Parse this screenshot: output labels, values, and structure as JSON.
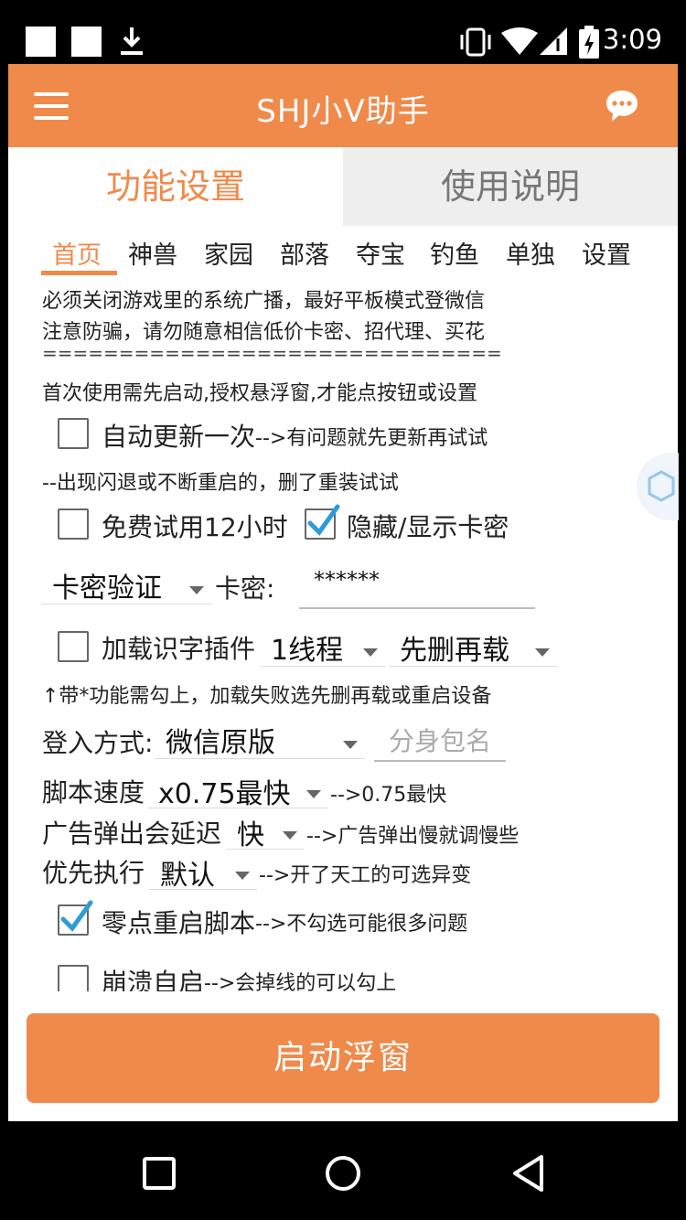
{
  "status_bar": {
    "time": "3:09"
  },
  "app_bar": {
    "title": "SHJ小V助手"
  },
  "main_tabs": [
    {
      "label": "功能设置"
    },
    {
      "label": "使用说明"
    }
  ],
  "sub_tabs": [
    "首页",
    "神兽",
    "家园",
    "部落",
    "夺宝",
    "钓鱼",
    "单独",
    "设置"
  ],
  "notice": {
    "line1": "必须关闭游戏里的系统广播，最好平板模式登微信",
    "line2": "注意防骗，请勿随意相信低价卡密、招代理、买花",
    "divider": "==============================",
    "line3": "首次使用需先启动,授权悬浮窗,才能点按钮或设置"
  },
  "auto_update": {
    "label": "自动更新一次",
    "hint": "-->有问题就先更新再试试"
  },
  "crash_hint": "--出现闪退或不断重启的，删了重装试试",
  "free_trial": {
    "label": "免费试用12小时"
  },
  "toggle_key": {
    "label": "隐藏/显示卡密"
  },
  "key_verify": {
    "selected": "卡密验证",
    "key_label": "卡密:",
    "key_value": "******"
  },
  "ocr_plugin": {
    "label": "加载识字插件",
    "threads": "1线程",
    "mode": "先删再载"
  },
  "plugin_hint": "↑带*功能需勾上，加载失败选先删再载或重启设备",
  "login": {
    "label": "登入方式:",
    "selected": "微信原版",
    "placeholder": "分身包名"
  },
  "script_speed": {
    "label": "脚本速度",
    "selected": "x0.75最快",
    "hint": "-->0.75最快"
  },
  "ad_delay": {
    "label": "广告弹出会延迟",
    "selected": "快",
    "hint": "-->广告弹出慢就调慢些"
  },
  "priority": {
    "label": "优先执行",
    "selected": "默认",
    "hint": "-->开了天工的可选异变"
  },
  "midnight_restart": {
    "label": "零点重启脚本",
    "hint": "-->不勾选可能很多问题"
  },
  "crash_restart": {
    "label": "崩溃自启",
    "hint": "-->会掉线的可以勾上"
  },
  "start_button": {
    "label": "启动浮窗"
  },
  "colors": {
    "accent": "#ef8a4b",
    "check": "#2f9bd6"
  }
}
